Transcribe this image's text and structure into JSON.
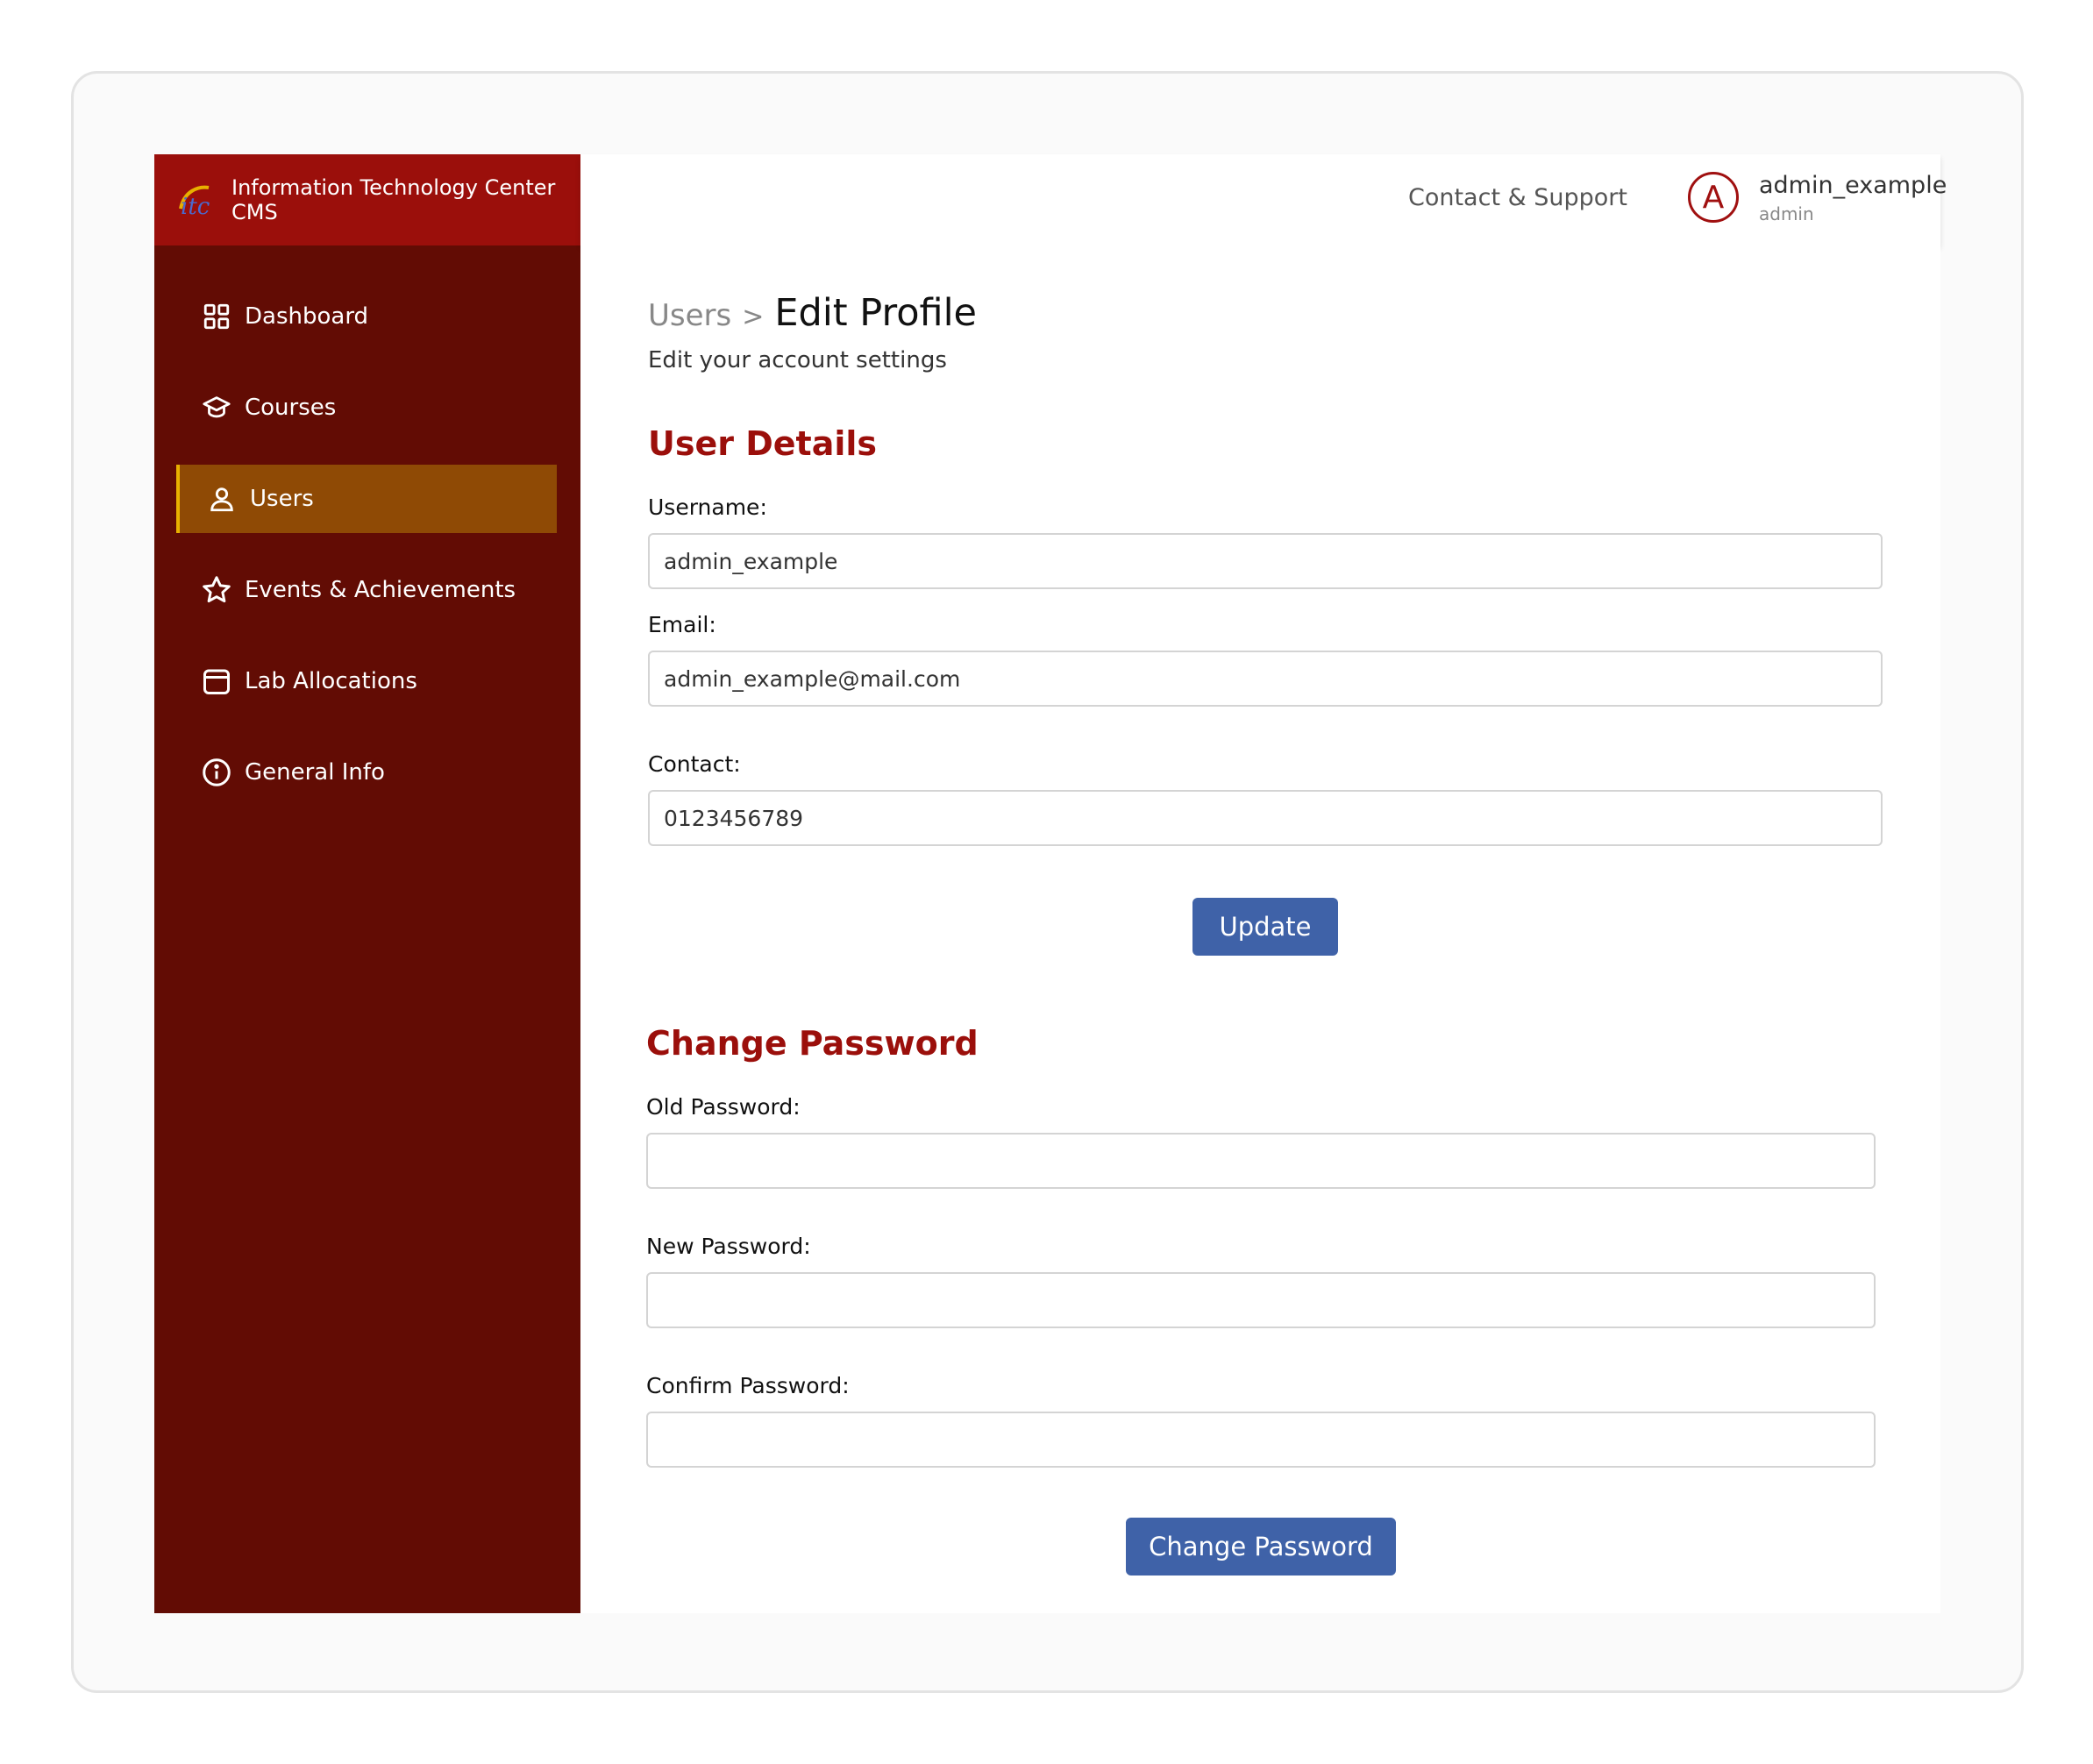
{
  "brand": {
    "line1": "Information Technology Center",
    "line2": "CMS"
  },
  "sidebar": {
    "items": [
      {
        "label": "Dashboard",
        "icon": "dashboard-icon"
      },
      {
        "label": "Courses",
        "icon": "graduation-cap-icon"
      },
      {
        "label": "Users",
        "icon": "user-icon",
        "active": true
      },
      {
        "label": "Events & Achievements",
        "icon": "star-icon"
      },
      {
        "label": "Lab Allocations",
        "icon": "calendar-icon"
      },
      {
        "label": "General Info",
        "icon": "info-icon"
      }
    ]
  },
  "header": {
    "contact_label": "Contact & Support",
    "avatar_letter": "A",
    "user_name": "admin_example",
    "user_role": "admin"
  },
  "page": {
    "breadcrumb_parent": "Users",
    "breadcrumb_sep": ">",
    "title": "Edit Profile",
    "subtitle": "Edit your account settings"
  },
  "user_details": {
    "title": "User Details",
    "username_label": "Username:",
    "username_value": "admin_example",
    "email_label": "Email:",
    "email_value": "admin_example@mail.com",
    "contact_label": "Contact:",
    "contact_value": "0123456789",
    "update_label": "Update"
  },
  "change_password": {
    "title": "Change Password",
    "old_label": "Old Password:",
    "new_label": "New Password:",
    "confirm_label": "Confirm Password:",
    "button_label": "Change Password"
  },
  "colors": {
    "brand_red": "#9b0f0b",
    "sidebar_bg": "#620c04",
    "active_item": "#8f4a05",
    "button_blue": "#3f62a8"
  }
}
